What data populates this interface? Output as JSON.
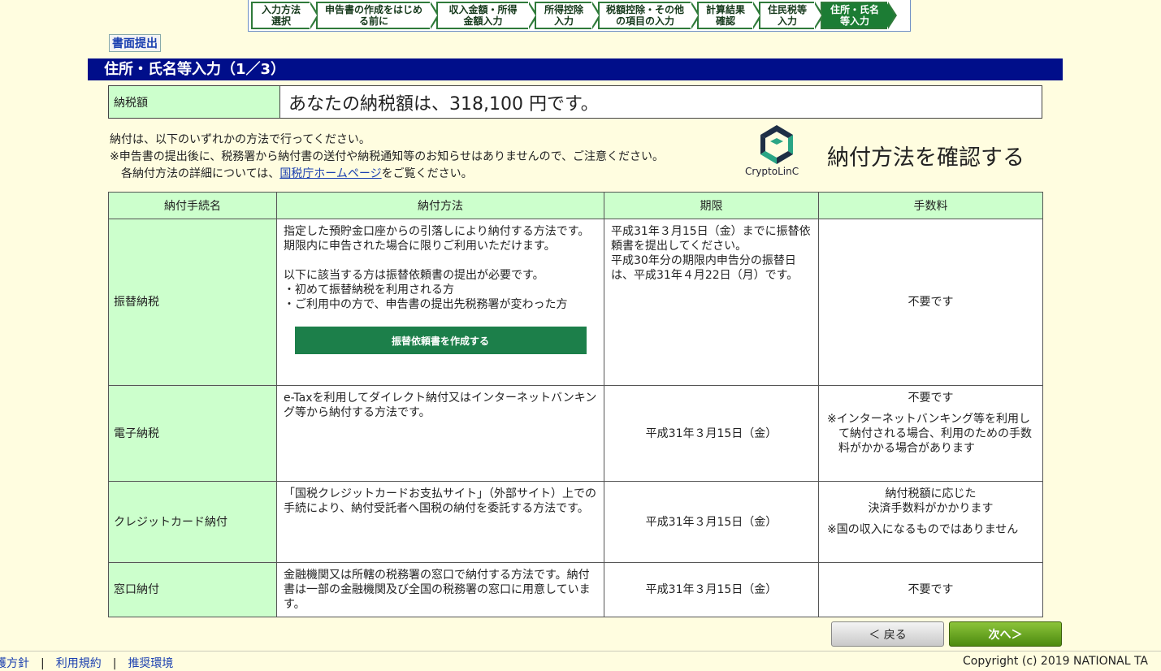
{
  "steps": [
    "入力方法\n選択",
    "申告書の作成をはじめ\nる前に",
    "収入金額・所得\n金額入力",
    "所得控除\n入力",
    "税額控除・その他\nの項目の入力",
    "計算結果\n確認",
    "住民税等\n入力",
    "住所・氏名\n等入力"
  ],
  "doc_button": "書面提出",
  "section_title": "住所・氏名等入力（1／3）",
  "amount": {
    "label": "納税額",
    "text": "あなたの納税額は、318,100 円です。"
  },
  "notes": {
    "line1": "納付は、以下のいずれかの方法で行ってください。",
    "line2": "※申告書の提出後に、税務署から納付書の送付や納税通知等のお知らせはありませんので、ご注意ください。",
    "line3_pre": "各納付方法の詳細については、",
    "line3_link": "国税庁ホームページ",
    "line3_post": "をご覧ください。"
  },
  "logo_text": "CryptoLinC",
  "confirm_text": "納付方法を確認する",
  "table": {
    "headers": [
      "納付手続名",
      "納付方法",
      "期限",
      "手数料"
    ],
    "rows": [
      {
        "name": "振替納税",
        "method_lines": [
          "指定した預貯金口座からの引落しにより納付する方法です。",
          "期限内に申告された場合に限りご利用いただけます。",
          "",
          "以下に該当する方は振替依頼書の提出が必要です。",
          "・初めて振替納税を利用される方",
          "・ご利用中の方で、申告書の提出先税務署が変わった方"
        ],
        "button": "振替依頼書を作成する",
        "deadline": "平成31年３月15日（金）までに振替依頼書を提出してください。\n平成30年分の期限内申告分の振替日は、平成31年４月22日（月）です。",
        "fee": "不要です"
      },
      {
        "name": "電子納税",
        "method": "e-Taxを利用してダイレクト納付又はインターネットバンキング等から納付する方法です。",
        "deadline": "平成31年３月15日（金）",
        "fee": "不要です",
        "fee_note": "※インターネットバンキング等を利用して納付される場合、利用のための手数料がかかる場合があります"
      },
      {
        "name": "クレジットカード納付",
        "method": "「国税クレジットカードお支払サイト」（外部サイト）上での手続により、納付受託者へ国税の納付を委託する方法です。",
        "deadline": "平成31年３月15日（金）",
        "fee": "納付税額に応じた\n決済手数料がかかります",
        "fee_note": "※国の収入になるものではありません"
      },
      {
        "name": "窓口納付",
        "method": "金融機関又は所轄の税務署の窓口で納付する方法です。納付書は一部の金融機関及び全国の税務署の窓口に用意しています。",
        "deadline": "平成31年３月15日（金）",
        "fee": "不要です"
      }
    ]
  },
  "nav": {
    "back": "＜ 戻る",
    "next": "次へ＞"
  },
  "footer": {
    "links": [
      "保護方針",
      "利用規約",
      "推奨環境"
    ],
    "copyright": "Copyright (c) 2019 NATIONAL TA"
  }
}
